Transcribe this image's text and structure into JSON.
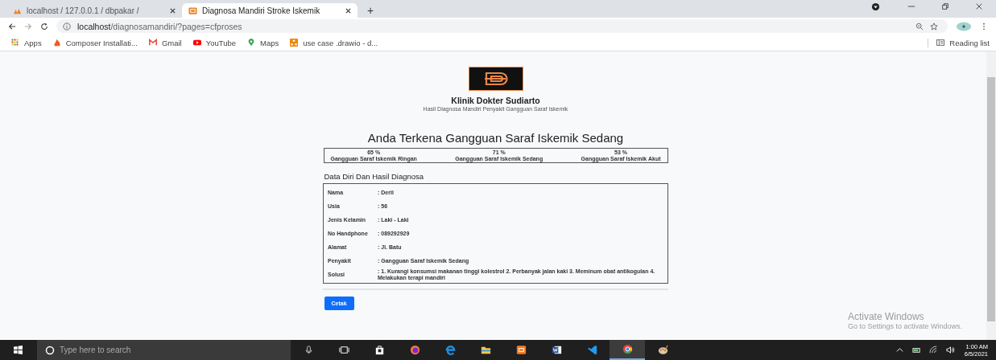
{
  "browser": {
    "tabs": [
      {
        "label": "localhost / 127.0.0.1 / dbpakar /",
        "selected": false,
        "kind": "pma"
      },
      {
        "label": "Diagnosa Mandiri Stroke Iskemik",
        "selected": true,
        "kind": "app"
      }
    ],
    "new_tab": "+",
    "address": {
      "host": "localhost",
      "path": "/diagnosamandiri/?pages=cfproses"
    },
    "bookmarks": [
      {
        "label": "Apps",
        "kind": "grid"
      },
      {
        "label": "Composer Installati...",
        "kind": "flame"
      },
      {
        "label": "Gmail",
        "kind": "mail"
      },
      {
        "label": "YouTube",
        "kind": "play"
      },
      {
        "label": "Maps",
        "kind": "pin"
      },
      {
        "label": "use case .drawio - d...",
        "kind": "diagram"
      }
    ],
    "reading_list": "Reading list"
  },
  "page": {
    "clinic_name": "Klinik Dokter Sudiarto",
    "subtitle": "Hasil Diagnosa Mandiri Penyakit Gangguan Saraf Iskemik",
    "heading": "Anda Terkena Gangguan Saraf Iskemik Sedang",
    "scores": [
      {
        "percent": "65 %",
        "label": "Gangguan Saraf Iskemik Ringan"
      },
      {
        "percent": "71 %",
        "label": "Gangguan Saraf Iskemik Sedang"
      },
      {
        "percent": "53 %",
        "label": "Gangguan Saraf Iskemik Akut"
      }
    ],
    "section_title": "Data Diri Dan Hasil Diagnosa",
    "details": [
      {
        "label": "Nama",
        "value": ": Deril"
      },
      {
        "label": "Usia",
        "value": ": 56"
      },
      {
        "label": "Jenis Kelamin",
        "value": ": Laki - Laki"
      },
      {
        "label": "No Handphone",
        "value": ": 089292929"
      },
      {
        "label": "Alamat",
        "value": ": Jl. Batu"
      },
      {
        "label": "Penyakit",
        "value": ": Gangguan Saraf Iskemik Sedang"
      },
      {
        "label": "Solusi",
        "value": ": 1. Kurangi konsumsi makanan tinggi kolestrol 2. Perbanyak jalan kaki 3. Meminum obat antikogulan 4. Melakukan terapi mandiri"
      }
    ],
    "print_button": "Cetak"
  },
  "watermark": {
    "title": "Activate Windows",
    "subtitle": "Go to Settings to activate Windows."
  },
  "taskbar": {
    "search_placeholder": "Type here to search",
    "apps": [
      {
        "kind": "mic",
        "selected": false
      },
      {
        "kind": "taskview",
        "selected": false
      },
      {
        "kind": "store",
        "selected": false
      },
      {
        "kind": "firefox",
        "selected": false
      },
      {
        "kind": "edge",
        "selected": false
      },
      {
        "kind": "folder",
        "selected": false
      },
      {
        "kind": "xampp",
        "selected": false
      },
      {
        "kind": "word",
        "selected": false
      },
      {
        "kind": "vscode",
        "selected": false
      },
      {
        "kind": "chrome",
        "selected": true
      },
      {
        "kind": "paint",
        "selected": false
      }
    ],
    "time": "1:00 AM",
    "date": "6/5/2021"
  }
}
